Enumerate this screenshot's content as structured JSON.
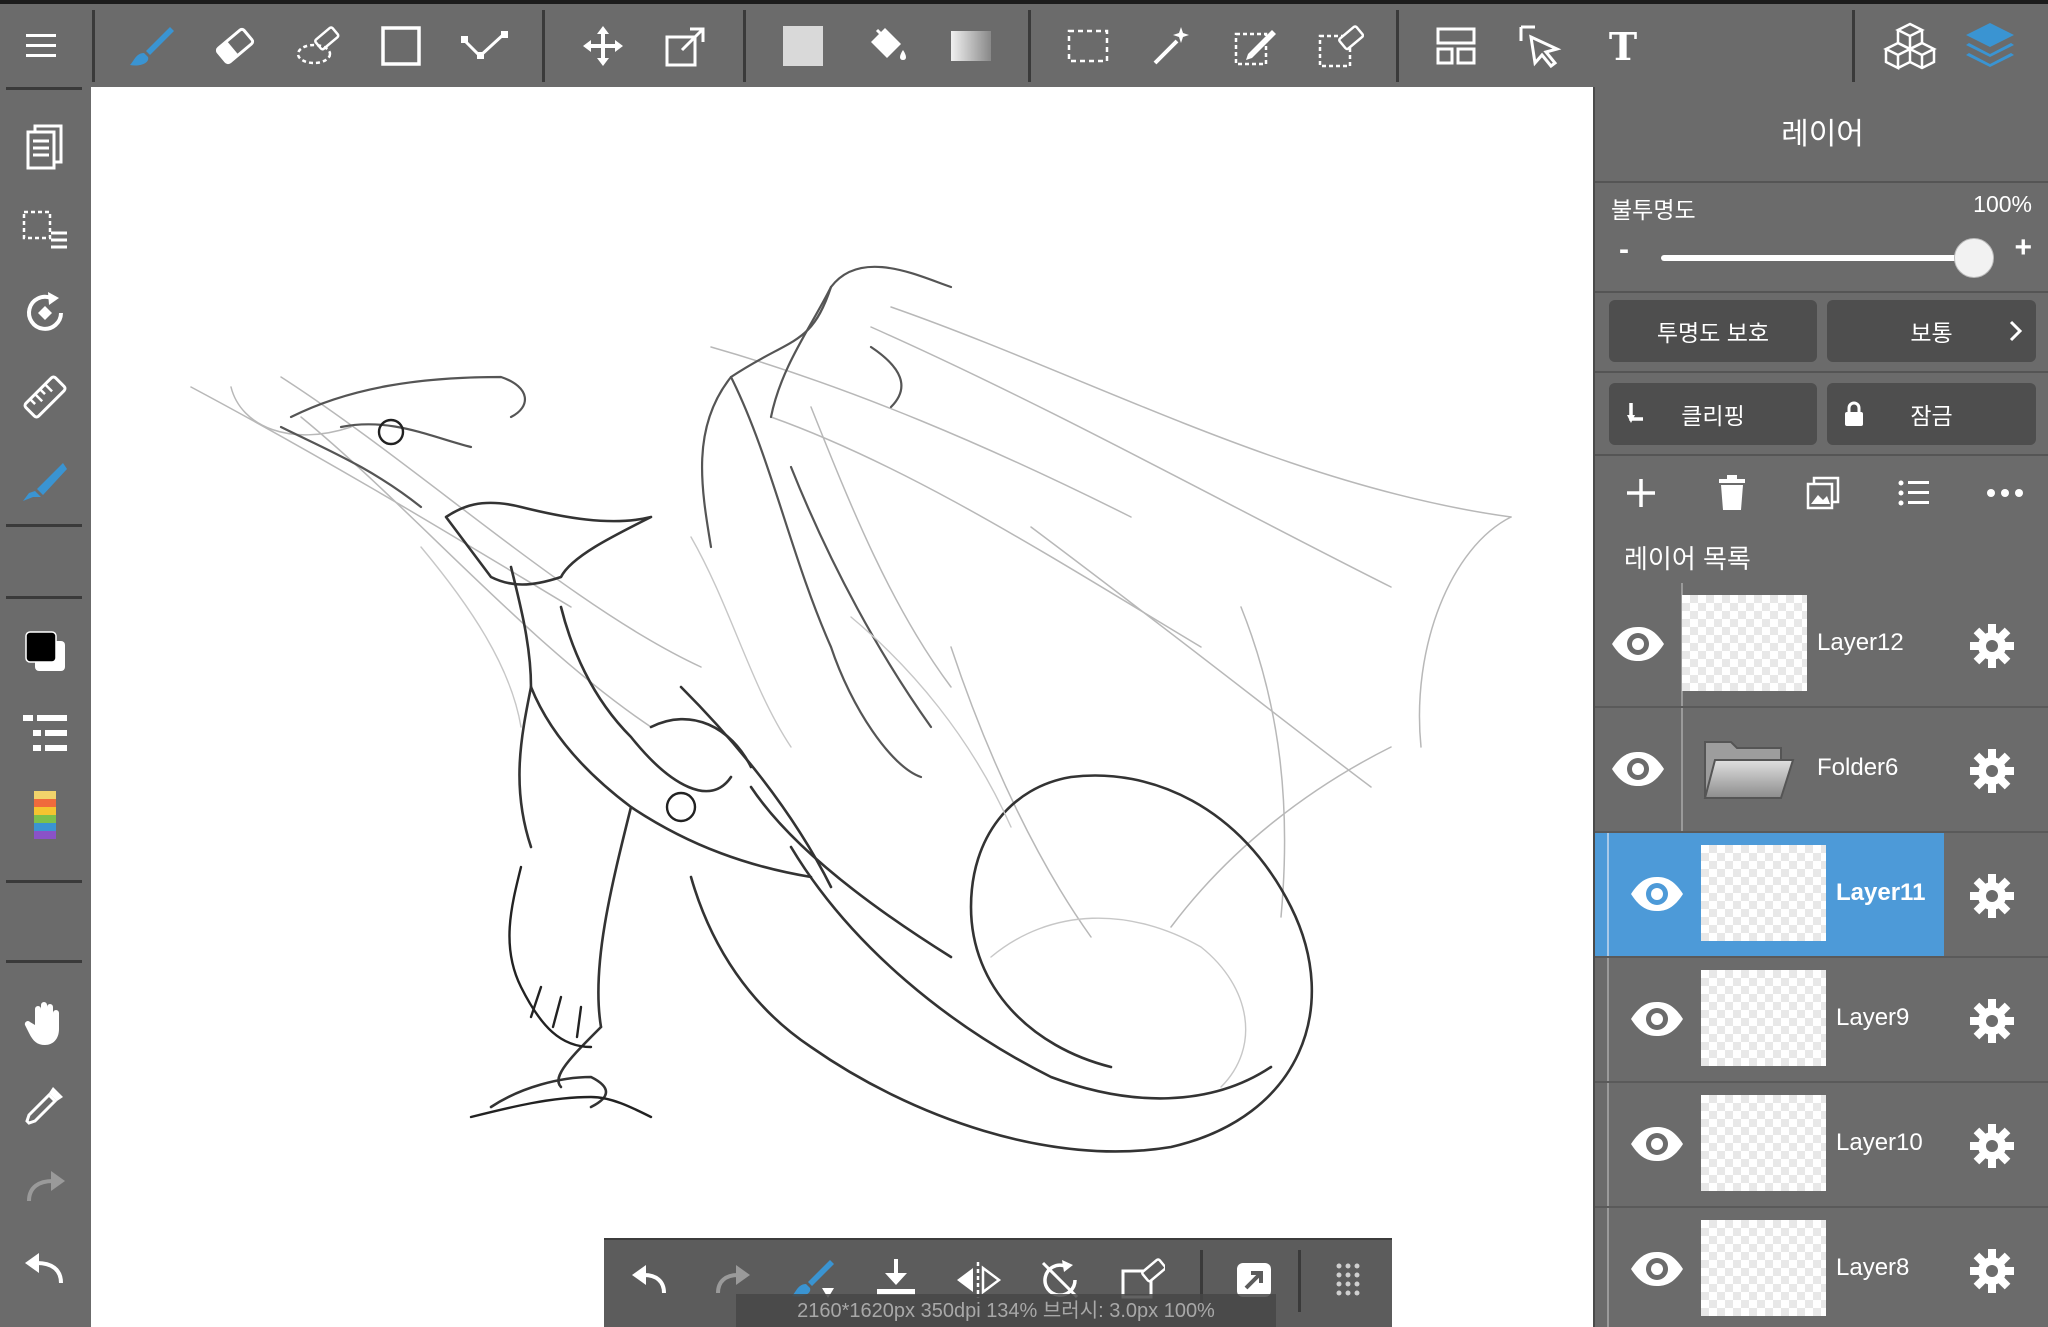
{
  "colors": {
    "panel_bg": "#6b6b6b",
    "accent_blue": "#3a94d2",
    "selected_row": "#4d9ad8",
    "separator": "#3a3a3a"
  },
  "top_toolbar": {
    "tools": [
      "menu-icon",
      "brush-icon",
      "eraser-icon",
      "blur-eraser-icon",
      "rectangle-icon",
      "curve-line-icon",
      "move-icon",
      "transform-icon",
      "fill-color-icon",
      "bucket-fill-icon",
      "gradient-icon",
      "selection-rect-icon",
      "magic-wand-icon",
      "selection-pen-icon",
      "selection-eraser-icon",
      "panel-layout-icon",
      "select-layer-icon",
      "text-icon",
      "material-icon",
      "layers-icon"
    ],
    "text_tool_glyph": "T"
  },
  "left_toolbar": {
    "tools": [
      "pages-icon",
      "selection-list-icon",
      "rotate-canvas-icon",
      "ruler-icon",
      "pen-color-icon",
      "color-swatch-icon",
      "brush-list-icon",
      "color-palette-icon",
      "hand-icon",
      "eyedropper-icon",
      "redo-icon",
      "undo-icon"
    ],
    "primary_color": "#000000",
    "secondary_color": "#ffffff"
  },
  "bottom_toolbar": {
    "tools": [
      "undo-icon",
      "redo-icon",
      "brush-select-icon",
      "import-icon",
      "flip-icon",
      "rotate-reset-icon",
      "edit-icon",
      "share-icon",
      "grip-icon"
    ],
    "status": "2160*1620px 350dpi 134% 브러시: 3.0px 100%"
  },
  "layer_panel": {
    "title": "레이어",
    "opacity_label": "불투명도",
    "opacity_value": "100%",
    "opacity_fraction": 1.0,
    "minus": "-",
    "plus": "+",
    "protect_alpha": "투명도 보호",
    "blend_mode": "보통",
    "clipping": "클리핑",
    "lock": "잠금",
    "list_title": "레이어 목록",
    "layers": [
      {
        "name": "Layer12",
        "type": "layer",
        "visible": true,
        "selected": false
      },
      {
        "name": "Folder6",
        "type": "folder",
        "visible": true,
        "selected": false
      },
      {
        "name": "Layer11",
        "type": "layer",
        "visible": true,
        "selected": true
      },
      {
        "name": "Layer9",
        "type": "layer",
        "visible": true,
        "selected": false
      },
      {
        "name": "Layer10",
        "type": "layer",
        "visible": true,
        "selected": false
      },
      {
        "name": "Layer8",
        "type": "layer",
        "visible": true,
        "selected": false
      }
    ]
  }
}
